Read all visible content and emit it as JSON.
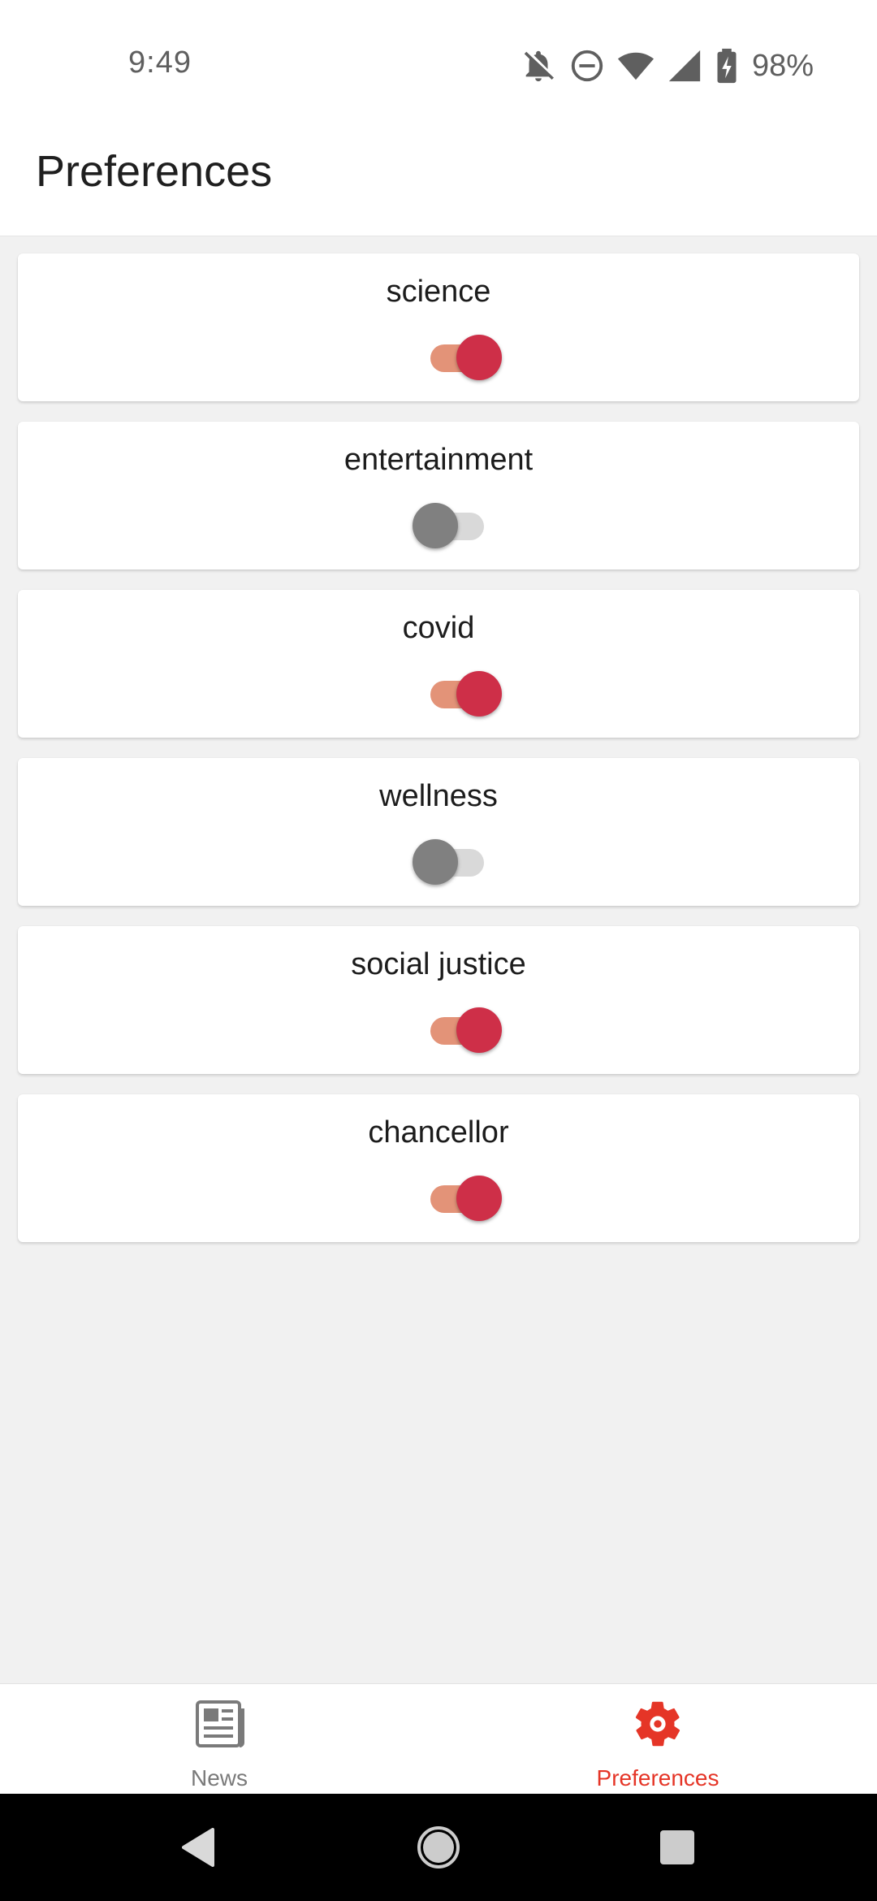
{
  "status_bar": {
    "time": "9:49",
    "battery": "98%",
    "icons": [
      "notifications-off-icon",
      "do-not-disturb-icon",
      "wifi-icon",
      "cell-signal-icon",
      "battery-charging-icon"
    ]
  },
  "app_bar": {
    "title": "Preferences"
  },
  "preferences": [
    {
      "label": "science",
      "enabled": true
    },
    {
      "label": "entertainment",
      "enabled": false
    },
    {
      "label": "covid",
      "enabled": true
    },
    {
      "label": "wellness",
      "enabled": false
    },
    {
      "label": "social justice",
      "enabled": true
    },
    {
      "label": "chancellor",
      "enabled": true
    }
  ],
  "bottom_nav": {
    "items": [
      {
        "label": "News",
        "icon": "newspaper-icon",
        "active": false
      },
      {
        "label": "Preferences",
        "icon": "gear-icon",
        "active": true
      }
    ]
  },
  "colors": {
    "accent": "#e53527",
    "toggle_on_thumb": "#ce2f48",
    "toggle_on_track": "#e39378",
    "toggle_off_thumb": "#808080",
    "toggle_off_track": "#d9d9d9",
    "background": "#f1f1f1"
  },
  "system_nav": {
    "buttons": [
      "back-icon",
      "home-icon",
      "recents-icon"
    ]
  }
}
